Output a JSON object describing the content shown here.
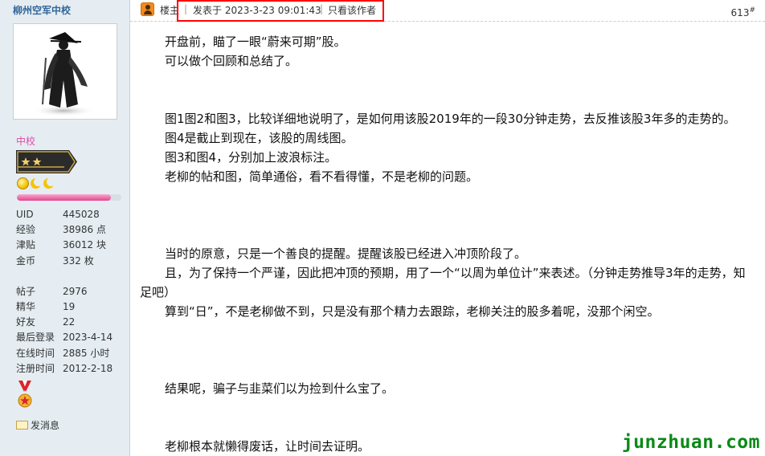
{
  "sidebar": {
    "username": "柳州空军中校",
    "rank": "中校",
    "stats_group1": [
      {
        "label": "UID",
        "value": "445028"
      },
      {
        "label": "经验",
        "value": "38986 点"
      },
      {
        "label": "津贴",
        "value": "36012 块"
      },
      {
        "label": "金币",
        "value": "332 枚"
      }
    ],
    "stats_group2": [
      {
        "label": "帖子",
        "value": "2976"
      },
      {
        "label": "精华",
        "value": "19"
      },
      {
        "label": "好友",
        "value": "22"
      },
      {
        "label": "最后登录",
        "value": "2023-4-14"
      },
      {
        "label": "在线时间",
        "value": "2885 小时"
      },
      {
        "label": "注册时间",
        "value": "2012-2-18"
      }
    ],
    "send_message": "发消息",
    "level_progress": 0.9
  },
  "header": {
    "floor_owner": "楼主",
    "separator": "|",
    "post_time": "发表于 2023-3-23 09:01:43",
    "only_author": "只看该作者",
    "post_number": "613",
    "post_number_suffix": "#"
  },
  "content": {
    "lines": [
      "开盘前，瞄了一眼“蔚来可期”股。",
      "可以做个回顾和总结了。",
      "",
      "",
      "图1图2和图3，比较详细地说明了，是如何用该股2019年的一段30分钟走势，去反推该股3年多的走势的。",
      "图4是截止到现在，该股的周线图。",
      "图3和图4，分别加上波浪标注。",
      "老柳的帖和图，简单通俗，看不看得懂，不是老柳的问题。",
      "",
      "",
      "",
      "当时的原意，只是一个善良的提醒。提醒该股已经进入冲顶阶段了。",
      "且，为了保持一个严谨，因此把冲顶的预期，用了一个“以周为单位计”来表述。（分钟走势推导3年的走势，知足吧）",
      "算到“日”，不是老柳做不到，只是没有那个精力去跟踪，老柳关注的股多着呢，没那个闲空。",
      "",
      "",
      "",
      "结果呢，骗子与韭菜们以为捡到什么宝了。",
      "",
      "",
      "老柳根本就懒得废话，让时间去证明。"
    ]
  },
  "watermark": "junzhuan.com",
  "colors": {
    "sidebar_bg": "#e5edf2",
    "username": "#336699",
    "rank": "#e24ba8",
    "highlight_box": "#ff0000",
    "watermark": "#0a8a16"
  }
}
